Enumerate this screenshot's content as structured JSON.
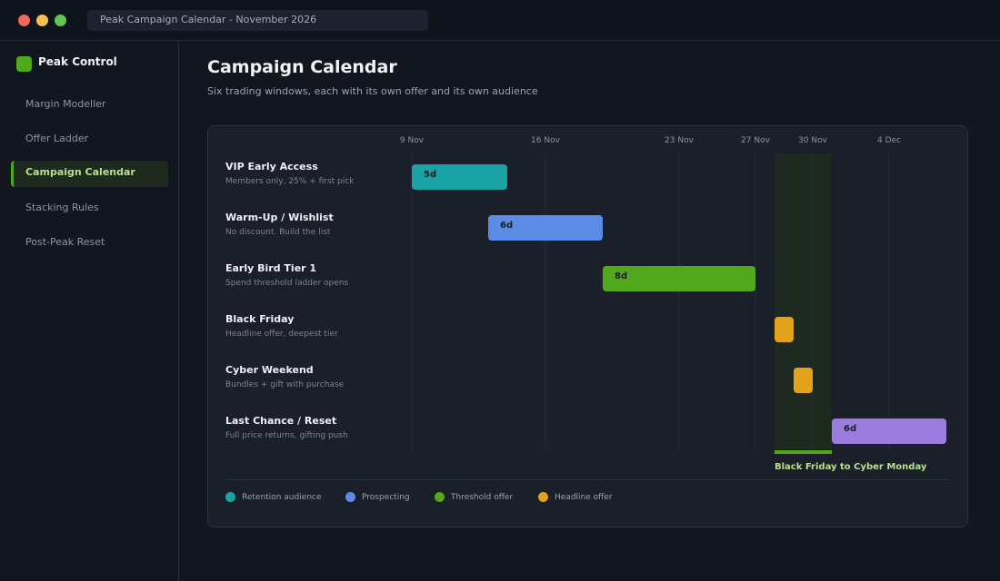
{
  "window": {
    "title": "Peak Campaign Calendar  -  November 2026"
  },
  "sidebar": {
    "brand": "Peak Control",
    "items": [
      {
        "label": "Margin Modeller",
        "active": false
      },
      {
        "label": "Offer Ladder",
        "active": false
      },
      {
        "label": "Campaign Calendar",
        "active": true
      },
      {
        "label": "Stacking Rules",
        "active": false
      },
      {
        "label": "Post-Peak Reset",
        "active": false
      }
    ]
  },
  "page": {
    "title": "Campaign Calendar",
    "subtitle": "Six trading windows, each with its own offer and its own audience"
  },
  "colors": {
    "retention": "#19a3a5",
    "prospecting": "#5b8ce6",
    "threshold": "#52a81d",
    "headline": "#e3a21c",
    "reset": "#9a7ddf",
    "peak_highlight": "#52a81d"
  },
  "legend": [
    {
      "label": "Retention audience",
      "color": "#19a3a5"
    },
    {
      "label": "Prospecting",
      "color": "#5b8ce6"
    },
    {
      "label": "Threshold offer",
      "color": "#52a81d"
    },
    {
      "label": "Headline offer",
      "color": "#e3a21c"
    }
  ],
  "chart_data": {
    "type": "gantt",
    "date_axis": {
      "start": "2026-11-09",
      "end": "2026-12-08",
      "ticks": [
        {
          "date": "2026-11-09",
          "label": "9 Nov"
        },
        {
          "date": "2026-11-16",
          "label": "16 Nov"
        },
        {
          "date": "2026-11-23",
          "label": "23 Nov"
        },
        {
          "date": "2026-11-27",
          "label": "27 Nov"
        },
        {
          "date": "2026-11-30",
          "label": "30 Nov"
        },
        {
          "date": "2026-12-04",
          "label": "4 Dec"
        }
      ]
    },
    "highlight": {
      "start": "2026-11-28",
      "end": "2026-12-01",
      "label": "Black Friday to Cyber Monday"
    },
    "tasks": [
      {
        "name": "VIP Early Access",
        "description": "Members only, 25% + first pick",
        "start": "2026-11-09",
        "end": "2026-11-14",
        "label": "5d",
        "color": "#19a3a5"
      },
      {
        "name": "Warm-Up / Wishlist",
        "description": "No discount. Build the list",
        "start": "2026-11-13",
        "end": "2026-11-19",
        "label": "6d",
        "color": "#5b8ce6"
      },
      {
        "name": "Early Bird Tier 1",
        "description": "Spend threshold ladder opens",
        "start": "2026-11-19",
        "end": "2026-11-27",
        "label": "8d",
        "color": "#52a81d"
      },
      {
        "name": "Black Friday",
        "description": "Headline offer, deepest tier",
        "start": "2026-11-28",
        "end": "2026-11-29",
        "label": "",
        "color": "#e3a21c"
      },
      {
        "name": "Cyber Weekend",
        "description": "Bundles + gift with purchase",
        "start": "2026-11-29",
        "end": "2026-11-30",
        "label": "",
        "color": "#e3a21c"
      },
      {
        "name": "Last Chance / Reset",
        "description": "Full price returns, gifting push",
        "start": "2026-12-01",
        "end": "2026-12-07",
        "label": "6d",
        "color": "#9a7ddf"
      }
    ]
  }
}
